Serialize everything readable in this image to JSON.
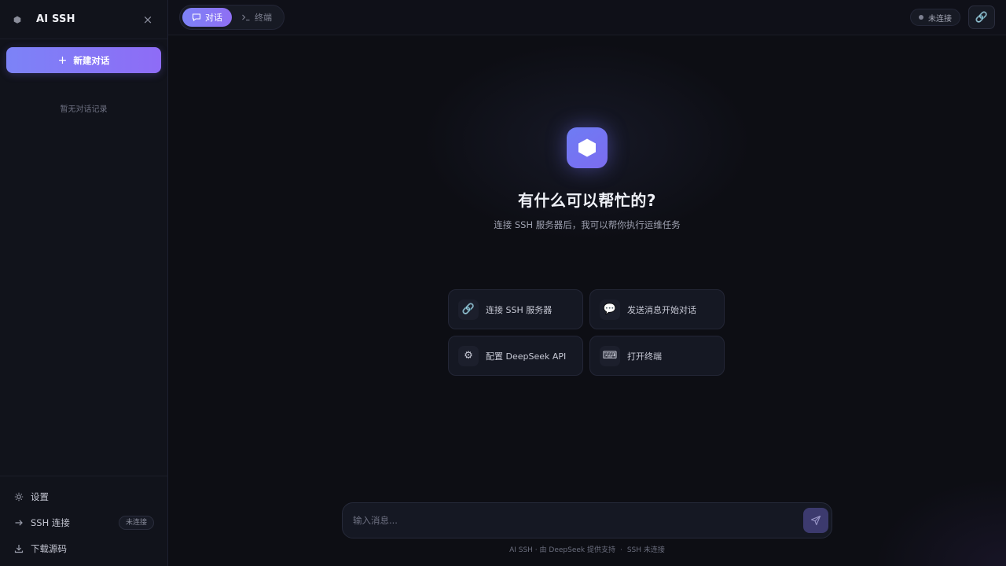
{
  "sidebar": {
    "title": "AI SSH",
    "close_glyph": "×",
    "new_chat_label": "新建对话",
    "empty_text": "暂无对话记录",
    "footer": {
      "settings_label": "设置",
      "ssh_label": "SSH 连接",
      "ssh_badge": "未连接",
      "download_label": "下载源码"
    }
  },
  "topbar": {
    "tabs": [
      {
        "label": "对话",
        "icon": "chat-icon",
        "active": true
      },
      {
        "label": "终端",
        "icon": "terminal-icon",
        "active": false
      }
    ],
    "status": "未连接",
    "link_icon": "🔗"
  },
  "hero": {
    "title": "有什么可以帮忙的?",
    "subtitle": "连接 SSH 服务器后，我可以帮你执行运维任务"
  },
  "cards": [
    {
      "label": "连接 SSH 服务器",
      "icon": "🔗",
      "icon_name": "link-icon"
    },
    {
      "label": "发送消息开始对话",
      "icon": "💬",
      "icon_name": "speech-bubble-icon"
    },
    {
      "label": "配置 DeepSeek API",
      "icon": "⚙",
      "icon_name": "gear-icon"
    },
    {
      "label": "打开终端",
      "icon": "⌨",
      "icon_name": "keyboard-icon"
    }
  ],
  "composer": {
    "placeholder": "输入消息..."
  },
  "footer": {
    "powered": "AI SSH · 由 DeepSeek 提供支持",
    "sep": "·",
    "ssh_status": "SSH 未连接"
  },
  "colors": {
    "accent_start": "#7d82f6",
    "accent_end": "#8f6ff4",
    "background": "#0d0e14"
  }
}
